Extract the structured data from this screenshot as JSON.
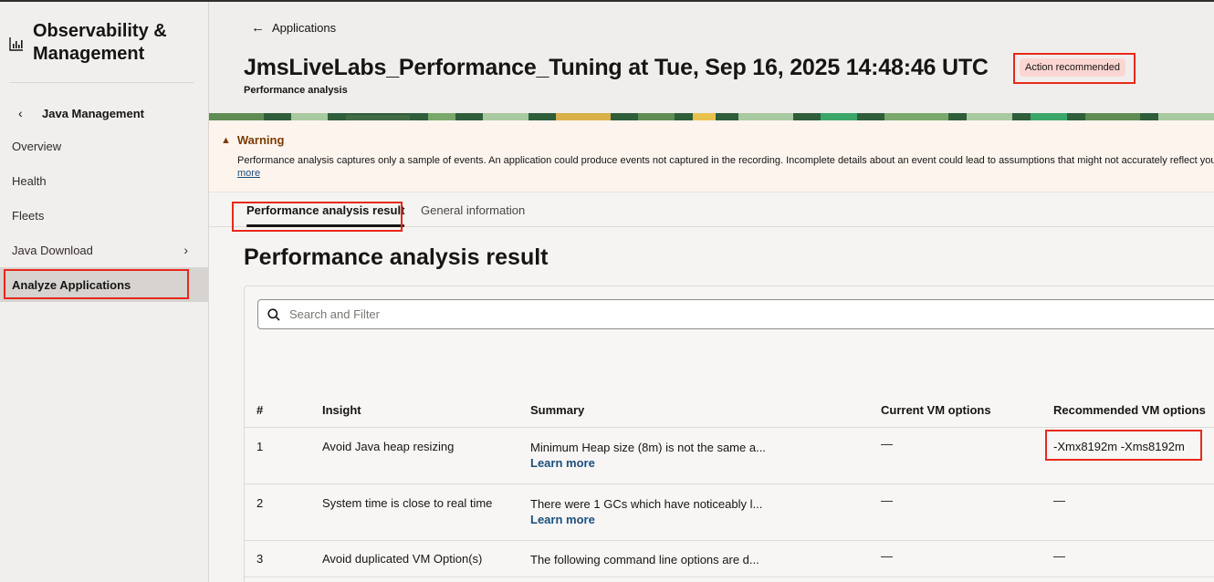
{
  "sidebar": {
    "brand_title": "Observability & Management",
    "back_label": "Java Management",
    "items": [
      {
        "label": "Overview"
      },
      {
        "label": "Health"
      },
      {
        "label": "Fleets"
      },
      {
        "label": "Java Download",
        "has_children": true
      },
      {
        "label": "Analyze Applications",
        "active": true
      }
    ]
  },
  "header": {
    "breadcrumb": "Applications",
    "title": "JmsLiveLabs_Performance_Tuning at Tue, Sep 16, 2025 14:48:46 UTC",
    "badge": "Action recommended",
    "subtitle": "Performance analysis"
  },
  "warning": {
    "heading": "Warning",
    "text": "Performance analysis captures only a sample of events. An application could produce events not captured in the recording. Incomplete details about an event could lead to assumptions that might not accurately reflect you",
    "more": "more"
  },
  "tabs": [
    {
      "label": "Performance analysis result",
      "active": true
    },
    {
      "label": "General information",
      "active": false
    }
  ],
  "section_title": "Performance analysis result",
  "search": {
    "placeholder": "Search and Filter",
    "value": ""
  },
  "table": {
    "columns": [
      "#",
      "Insight",
      "Summary",
      "Current VM options",
      "Recommended VM options"
    ],
    "rows": [
      {
        "num": "1",
        "insight": "Avoid Java heap resizing",
        "summary": "Minimum Heap size (8m) is not the same a...",
        "link": "Learn more",
        "current": "—",
        "recommended": "-Xmx8192m -Xms8192m"
      },
      {
        "num": "2",
        "insight": "System time is close to real time",
        "summary": "There were 1 GCs which have noticeably l...",
        "link": "Learn more",
        "current": "—",
        "recommended": "—"
      },
      {
        "num": "3",
        "insight": "Avoid duplicated VM Option(s)",
        "summary": "The following command line options are d...",
        "link": "",
        "current": "—",
        "recommended": "—"
      }
    ]
  },
  "colors": {
    "accent_link": "#1d4f7c",
    "highlight_red": "#e8291b",
    "badge_bg": "#fbd6d2",
    "warning_bg": "#fdf4ee"
  }
}
